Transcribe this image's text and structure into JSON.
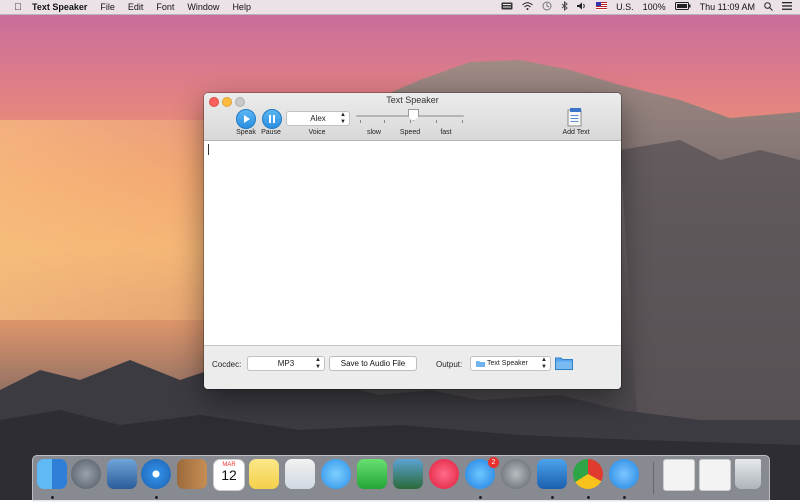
{
  "menubar": {
    "app_name": "Text Speaker",
    "menus": [
      "File",
      "Edit",
      "Font",
      "Window",
      "Help"
    ],
    "input_source": "U.S.",
    "battery": "100%",
    "clock": "Thu 11:09 AM"
  },
  "window": {
    "title": "Text Speaker",
    "toolbar": {
      "speak_label": "Speak",
      "pause_label": "Pause",
      "voice_value": "Alex",
      "voice_label": "Voice",
      "speed_slow": "slow",
      "speed_label": "Speed",
      "speed_fast": "fast",
      "add_text_label": "Add Text"
    },
    "bottom": {
      "codec_label": "Cocdec:",
      "codec_value": "MP3",
      "save_button": "Save to Audio File",
      "output_label": "Output:",
      "output_value": "Text Speaker"
    }
  },
  "dock": {
    "app_store_badge": "2",
    "calendar_month": "MAR",
    "calendar_day": "12",
    "items": [
      "finder-icon",
      "launchpad-icon",
      "photo-icon",
      "safari-icon",
      "contacts-icon",
      "calendar-icon",
      "notes-icon",
      "preview-icon",
      "messages-icon",
      "facetime-icon",
      "iphoto-icon",
      "itunes-icon",
      "app-store-icon",
      "system-preferences-icon",
      "xcode-icon",
      "chrome-icon",
      "text-speaker-icon",
      "downloads-stack-icon",
      "documents-stack-icon",
      "trash-icon"
    ]
  },
  "colors": {
    "accent": "#2b8fe0",
    "close": "#fc605c",
    "minimize": "#fdbc40"
  }
}
